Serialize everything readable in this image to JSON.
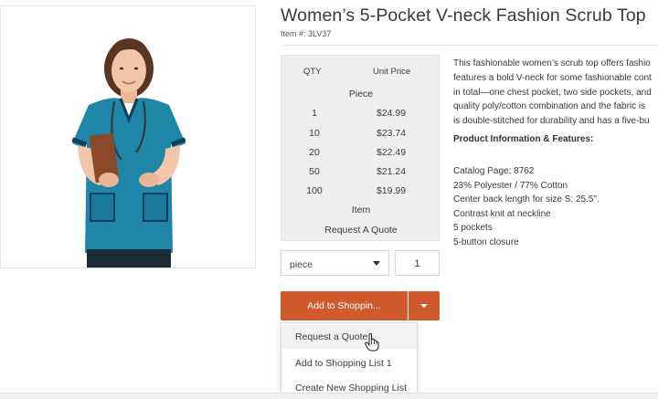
{
  "product": {
    "title": "Women’s 5-Pocket V-neck Fashion Scrub Top",
    "item_number": "Item #: 3LV37"
  },
  "pricing": {
    "qty_header": "QTY",
    "unit_price_header": "Unit Price",
    "unit_label": "Piece",
    "rows": [
      {
        "qty": "1",
        "price": "$24.99"
      },
      {
        "qty": "10",
        "price": "$23.74"
      },
      {
        "qty": "20",
        "price": "$22.49"
      },
      {
        "qty": "50",
        "price": "$21.24"
      },
      {
        "qty": "100",
        "price": "$19.99"
      }
    ],
    "item_label": "Item",
    "request_quote": "Request A Quote"
  },
  "purchase": {
    "unit_select_value": "piece",
    "quantity_value": "1",
    "add_button_label": "Add to Shoppin..."
  },
  "dropdown": {
    "options": [
      "Request a Quote",
      "Add to Shopping List 1",
      "Create New Shopping List"
    ],
    "hovered_option": "Request a Quote"
  },
  "description": {
    "lines": [
      "This fashionable women’s scrub top offers fashio",
      "features a bold V-neck for some fashionable cont",
      "in total—one chest pocket, two side pockets, and",
      "quality poly/cotton combination and the fabric is",
      "is double-stitched for durability and has a five-bu"
    ],
    "features_heading": "Product Information & Features:",
    "specs": [
      "Catalog Page: 8762",
      "23% Polyester / 77% Cotton",
      "Center back length for size S: 25.5\".",
      "Contrast knit at neckline",
      "5 pockets",
      "5-button closure"
    ]
  },
  "colors": {
    "accent": "#d05a2c",
    "scrub_teal": "#1f86a8",
    "price_box_bg": "#efefef"
  },
  "icons": {
    "unit_select_caret": "chevron-down-icon",
    "add_menu_caret": "chevron-down-icon",
    "pointer": "hand-pointer-icon"
  }
}
